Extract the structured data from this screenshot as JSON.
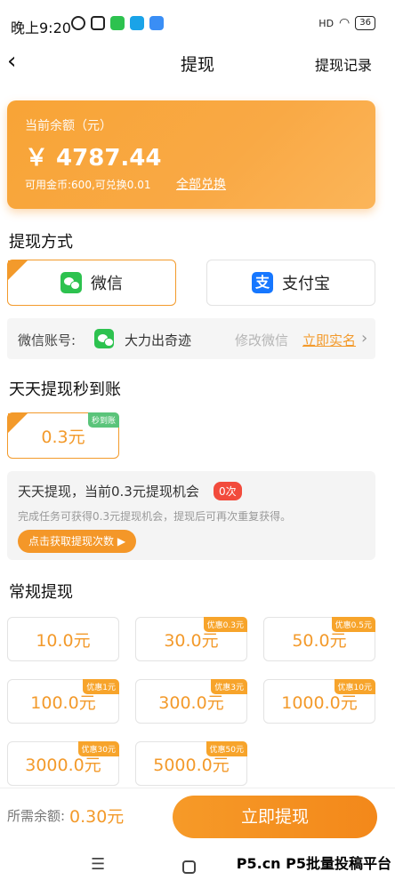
{
  "status": {
    "time": "晚上9:20",
    "network": "HD",
    "battery": "36"
  },
  "nav": {
    "back_icon": "chevron-left-icon",
    "title": "提现",
    "record": "提现记录"
  },
  "balance": {
    "label": "当前余额（元）",
    "amount": "￥ 4787.44",
    "coins_note": "可用金币:600,可兑换0.01",
    "exchange_all": "全部兑换"
  },
  "method": {
    "title": "提现方式",
    "options": [
      {
        "label": "微信",
        "icon": "wechat-icon",
        "selected": true
      },
      {
        "label": "支付宝",
        "icon": "alipay-icon",
        "selected": false
      }
    ],
    "account_label": "微信账号:",
    "account_name": "大力出奇迹",
    "edit": "修改微信",
    "verify": "立即实名"
  },
  "daily": {
    "title": "天天提现秒到账",
    "option": {
      "amount": "0.3元",
      "badge": "秒到账",
      "selected": true
    },
    "tip_title": "天天提现，当前0.3元提现机会",
    "tip_count": "0次",
    "tip_desc": "完成任务可获得0.3元提现机会，提现后可再次重复获得。",
    "tip_button": "点击获取提现次数 ▶"
  },
  "regular": {
    "title": "常规提现",
    "options": [
      {
        "amount": "10.0元",
        "badge": ""
      },
      {
        "amount": "30.0元",
        "badge": "优惠0.3元"
      },
      {
        "amount": "50.0元",
        "badge": "优惠0.5元"
      },
      {
        "amount": "100.0元",
        "badge": "优惠1元"
      },
      {
        "amount": "300.0元",
        "badge": "优惠3元"
      },
      {
        "amount": "1000.0元",
        "badge": "优惠10元"
      },
      {
        "amount": "3000.0元",
        "badge": "优惠30元"
      },
      {
        "amount": "5000.0元",
        "badge": "优惠50元"
      }
    ]
  },
  "bottom": {
    "need_label": "所需余额:",
    "need_value": "0.30元",
    "submit": "立即提现"
  },
  "system_nav": {
    "menu_icon": "menu-icon",
    "home_icon": "home-square-icon"
  },
  "watermark": "P5.cn P5批量投稿平台",
  "colors": {
    "accent": "#f39a2b",
    "wechat": "#2dc24f",
    "alipay": "#1677ff",
    "badge_red": "#f24b3c"
  }
}
